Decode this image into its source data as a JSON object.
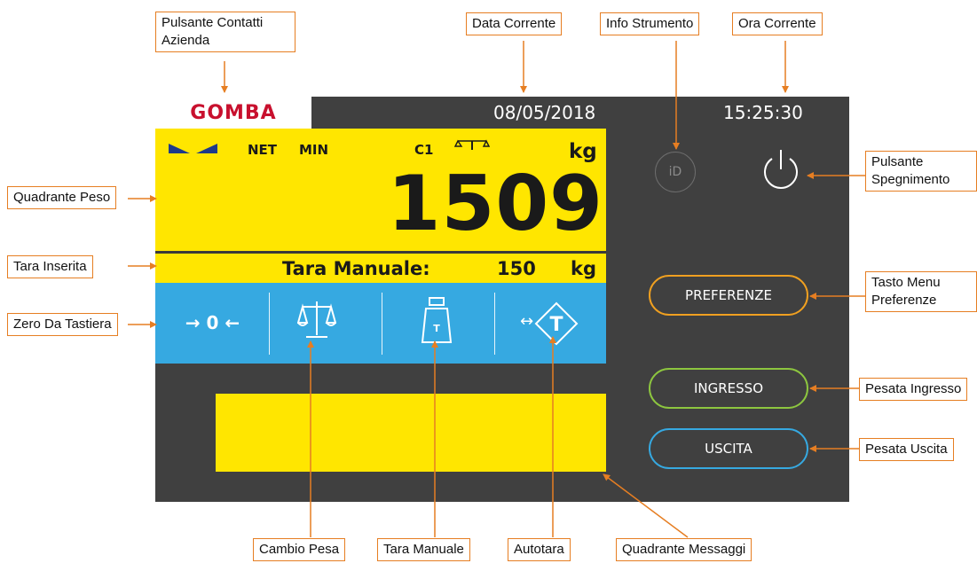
{
  "device": {
    "brand": "GOMBA",
    "date": "08/05/2018",
    "time": "15:25:30",
    "indicators": {
      "net": "NET",
      "min": "MIN",
      "channel": "C1"
    },
    "weight": {
      "value": "1509",
      "unit": "kg"
    },
    "tare": {
      "label": "Tara Manuale:",
      "value": "150",
      "unit": "kg"
    },
    "zero_label": "→ 0 ←",
    "autotare_arrow": "↔",
    "id_label": "iD",
    "buttons": {
      "preferences": "PREFERENZE",
      "entry": "INGRESSO",
      "exit": "USCITA"
    }
  },
  "callouts": {
    "company_contacts": "Pulsante Contatti Azienda",
    "current_date": "Data Corrente",
    "instrument_info": "Info Strumento",
    "current_time": "Ora Corrente",
    "power_button": "Pulsante Spegnimento",
    "weight_panel": "Quadrante Peso",
    "tare_entered": "Tara Inserita",
    "keyboard_zero": "Zero Da Tastiera",
    "preferences_menu": "Tasto Menu Preferenze",
    "entry_weighing": "Pesata Ingresso",
    "exit_weighing": "Pesata Uscita",
    "change_scale": "Cambio Pesa",
    "manual_tare": "Tara Manuale",
    "autotare": "Autotara",
    "message_panel": "Quadrante Messaggi"
  },
  "colors": {
    "callout_border": "#e67e22",
    "panel_yellow": "#ffe600",
    "button_bar_blue": "#36a9e1",
    "device_body": "#404040",
    "brand_red": "#c8102e",
    "pill_preferences": "#f0a020",
    "pill_entry": "#8dc63f",
    "pill_exit": "#36a9e1"
  },
  "icons": [
    "zero-icon",
    "scale-balance-icon",
    "tare-weight-icon",
    "autotare-icon",
    "power-icon",
    "info-id-icon",
    "stability-wave-icon",
    "balance-small-icon"
  ]
}
